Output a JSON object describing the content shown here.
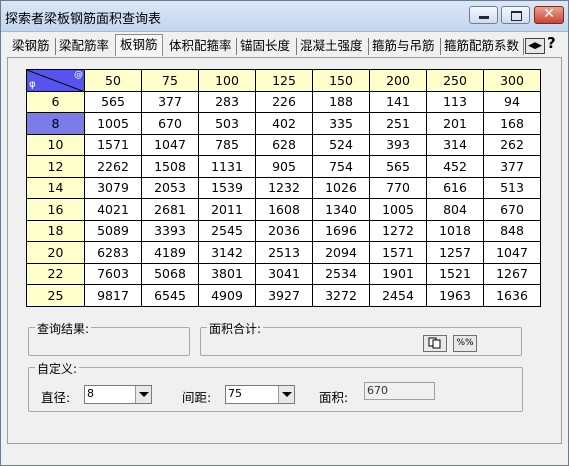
{
  "window": {
    "title": "探索者梁板钢筋面积查询表",
    "close_glyph": "✕"
  },
  "tabs": [
    {
      "label": "梁钢筋"
    },
    {
      "label": "梁配筋率"
    },
    {
      "label": "板钢筋",
      "active": true
    },
    {
      "label": "体积配箍率"
    },
    {
      "label": "锚固长度"
    },
    {
      "label": "混凝土强度"
    },
    {
      "label": "箍筋与吊筋"
    },
    {
      "label": "箍筋配筋系数"
    }
  ],
  "tab_nav": {
    "arrows_icon": "tab-scroll-arrows-icon",
    "help_icon": "help-icon",
    "help_glyph": "?"
  },
  "table": {
    "corner_symbol": "φ",
    "corner_at": "@",
    "spacing_headers": [
      "50",
      "75",
      "100",
      "125",
      "150",
      "200",
      "250",
      "300"
    ],
    "selected_diameter": "8",
    "rows": [
      {
        "d": "6",
        "cells": [
          "565",
          "377",
          "283",
          "226",
          "188",
          "141",
          "113",
          "94"
        ]
      },
      {
        "d": "8",
        "cells": [
          "1005",
          "670",
          "503",
          "402",
          "335",
          "251",
          "201",
          "168"
        ]
      },
      {
        "d": "10",
        "cells": [
          "1571",
          "1047",
          "785",
          "628",
          "524",
          "393",
          "314",
          "262"
        ]
      },
      {
        "d": "12",
        "cells": [
          "2262",
          "1508",
          "1131",
          "905",
          "754",
          "565",
          "452",
          "377"
        ]
      },
      {
        "d": "14",
        "cells": [
          "3079",
          "2053",
          "1539",
          "1232",
          "1026",
          "770",
          "616",
          "513"
        ]
      },
      {
        "d": "16",
        "cells": [
          "4021",
          "2681",
          "2011",
          "1608",
          "1340",
          "1005",
          "804",
          "670"
        ]
      },
      {
        "d": "18",
        "cells": [
          "5089",
          "3393",
          "2545",
          "2036",
          "1696",
          "1272",
          "1018",
          "848"
        ]
      },
      {
        "d": "20",
        "cells": [
          "6283",
          "4189",
          "3142",
          "2513",
          "2094",
          "1571",
          "1257",
          "1047"
        ]
      },
      {
        "d": "22",
        "cells": [
          "7603",
          "5068",
          "3801",
          "3041",
          "2534",
          "1901",
          "1521",
          "1267"
        ]
      },
      {
        "d": "25",
        "cells": [
          "9817",
          "6545",
          "4909",
          "3927",
          "3272",
          "2454",
          "1963",
          "1636"
        ]
      }
    ]
  },
  "query_result": {
    "label": "查询结果:"
  },
  "area_total": {
    "label": "面积合计:",
    "copy_icon": "copy-icon",
    "percent_label": "%%"
  },
  "custom": {
    "label": "自定义:",
    "diameter_label": "直径:",
    "diameter_value": "8",
    "spacing_label": "间距:",
    "spacing_value": "75",
    "area_label": "面积:",
    "area_value": "670"
  },
  "colors": {
    "header_bg": "#ffffcc",
    "selected_row_bg": "#7b7bea",
    "corner_bg": "#5555ee"
  }
}
